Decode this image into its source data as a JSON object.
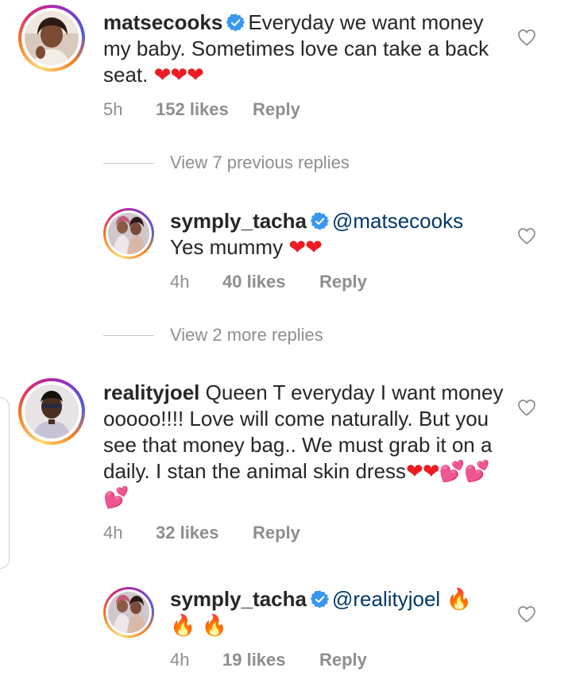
{
  "colors": {
    "text": "#262626",
    "meta": "#8e8e8e",
    "mention": "#00376b",
    "verified": "#3897f0",
    "heart": "#ed1c24"
  },
  "comments": [
    {
      "username": "matsecooks",
      "verified": true,
      "text": "Everyday we want money my baby. Sometimes love can take a back seat.",
      "emoji": "❤❤❤",
      "time": "5h",
      "likes": "152 likes",
      "reply_label": "Reply"
    },
    {
      "username": "symply_tacha",
      "verified": true,
      "mention": "@matsecooks",
      "text": "Yes mummy",
      "emoji": "❤❤",
      "time": "4h",
      "likes": "40 likes",
      "reply_label": "Reply"
    },
    {
      "username": "realityjoel",
      "verified": false,
      "text": "Queen T everyday I want money ooooo!!!! Love will come naturally. But you see that money bag.. We must grab it on a daily. I stan the animal skin dress",
      "emoji": "❤❤💕💕💕",
      "time": "4h",
      "likes": "32 likes",
      "reply_label": "Reply"
    },
    {
      "username": "symply_tacha",
      "verified": true,
      "mention": "@realityjoel",
      "emoji": "🔥 🔥 🔥",
      "time": "4h",
      "likes": "19 likes",
      "reply_label": "Reply"
    }
  ],
  "view_replies": [
    {
      "label": "View 7 previous replies"
    },
    {
      "label": "View 2 more replies"
    }
  ]
}
